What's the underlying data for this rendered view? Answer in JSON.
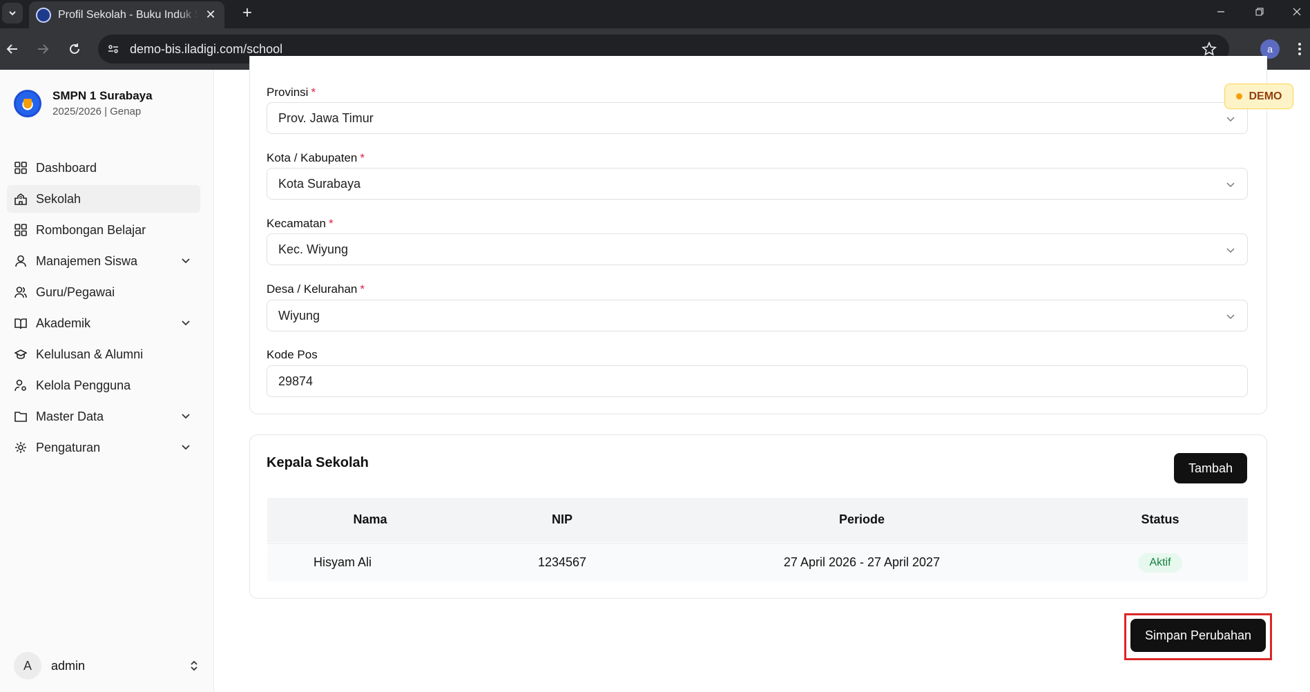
{
  "browser": {
    "tab_title": "Profil Sekolah - Buku Induk Siswa",
    "tab_close": "✕",
    "new_tab": "+",
    "url": "demo-bis.iladigi.com/school",
    "profile_initial": "a"
  },
  "sidebar": {
    "school_name": "SMPN 1 Surabaya",
    "school_period": "2025/2026 | Genap",
    "items": [
      {
        "label": "Dashboard",
        "icon": "grid-icon"
      },
      {
        "label": "Sekolah",
        "icon": "school-icon",
        "active": true
      },
      {
        "label": "Rombongan Belajar",
        "icon": "grid-icon"
      },
      {
        "label": "Manajemen Siswa",
        "icon": "user-icon",
        "expandable": true
      },
      {
        "label": "Guru/Pegawai",
        "icon": "users-icon"
      },
      {
        "label": "Akademik",
        "icon": "book-icon",
        "expandable": true
      },
      {
        "label": "Kelulusan & Alumni",
        "icon": "graduation-cap-icon"
      },
      {
        "label": "Kelola Pengguna",
        "icon": "user-cog-icon"
      },
      {
        "label": "Master Data",
        "icon": "folder-icon",
        "expandable": true
      },
      {
        "label": "Pengaturan",
        "icon": "gear-icon",
        "expandable": true
      }
    ],
    "user": {
      "initial": "A",
      "name": "admin"
    }
  },
  "demo_badge": "DEMO",
  "form": {
    "provinsi": {
      "label": "Provinsi",
      "required_mark": "*",
      "value": "Prov. Jawa Timur"
    },
    "kota": {
      "label": "Kota / Kabupaten",
      "required_mark": "*",
      "value": "Kota Surabaya"
    },
    "kecamatan": {
      "label": "Kecamatan",
      "required_mark": "*",
      "value": "Kec. Wiyung"
    },
    "desa": {
      "label": "Desa / Kelurahan",
      "required_mark": "*",
      "value": "Wiyung"
    },
    "kode_pos": {
      "label": "Kode Pos",
      "value": "29874"
    }
  },
  "kepala_sekolah": {
    "title": "Kepala Sekolah",
    "add_button": "Tambah",
    "columns": [
      "Nama",
      "NIP",
      "Periode",
      "Status"
    ],
    "rows": [
      {
        "nama": "Hisyam Ali",
        "nip": "1234567",
        "periode": "27 April 2026 - 27 April 2027",
        "status": "Aktif"
      }
    ]
  },
  "save_button": "Simpan Perubahan",
  "colors": {
    "accent_dark": "#111111",
    "required": "#e11d48",
    "status_active_bg": "#e7f8ee",
    "status_active_text": "#15803d",
    "highlight": "#dc2626"
  }
}
